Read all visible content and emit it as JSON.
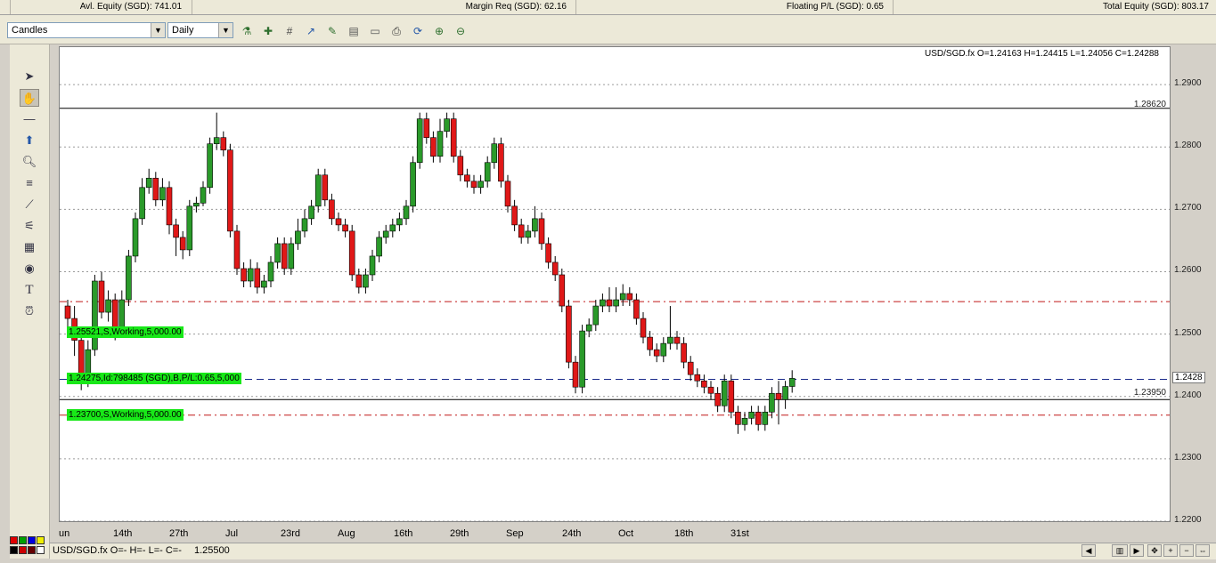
{
  "topbar": {
    "avl_equity": "Avl. Equity (SGD): 741.01",
    "margin_req": "Margin Req (SGD): 62.16",
    "floating_pl": "Floating P/L (SGD): 0.65",
    "total_equity": "Total Equity (SGD): 803.17"
  },
  "toolbar": {
    "chart_type": "Candles",
    "period": "Daily"
  },
  "chart": {
    "ohlc": "USD/SGD.fx O=1.24163 H=1.24415 L=1.24056 C=1.24288",
    "hline_top_label": "1.28620",
    "hline_bottom_label": "1.23950",
    "current_price_tag": "1.2428",
    "orders": [
      {
        "label": "1.25521,S,Working,5,000.00",
        "price": 1.25521
      },
      {
        "label": "1.24275,Id:798485 (SGD),B,P/L:0.65,5,000",
        "price": 1.24275
      },
      {
        "label": "1.23700,S,Working,5,000.00",
        "price": 1.237
      }
    ]
  },
  "chart_data": {
    "type": "candlestick",
    "symbol": "USD/SGD.fx",
    "ylim": [
      1.22,
      1.296
    ],
    "y_ticks": [
      "1.2900",
      "1.2800",
      "1.2700",
      "1.2600",
      "1.2500",
      "1.2400",
      "1.2300",
      "1.2200"
    ],
    "x_ticks": [
      "un",
      "14th",
      "27th",
      "Jul",
      "23rd",
      "Aug",
      "16th",
      "29th",
      "Sep",
      "24th",
      "Oct",
      "18th",
      "31st"
    ],
    "hlines": [
      1.2862,
      1.2395
    ],
    "candles": [
      [
        1.2545,
        1.2525,
        1.2555,
        1.251
      ],
      [
        1.2525,
        1.249,
        1.2545,
        1.2465
      ],
      [
        1.249,
        1.2425,
        1.2505,
        1.241
      ],
      [
        1.2425,
        1.2475,
        1.249,
        1.2415
      ],
      [
        1.2475,
        1.2585,
        1.2595,
        1.2465
      ],
      [
        1.2585,
        1.2535,
        1.26,
        1.2525
      ],
      [
        1.2535,
        1.2555,
        1.257,
        1.252
      ],
      [
        1.2555,
        1.2505,
        1.2565,
        1.249
      ],
      [
        1.2505,
        1.2555,
        1.257,
        1.2495
      ],
      [
        1.2555,
        1.2625,
        1.2635,
        1.2545
      ],
      [
        1.2625,
        1.2685,
        1.2695,
        1.2615
      ],
      [
        1.2685,
        1.2735,
        1.275,
        1.2675
      ],
      [
        1.2735,
        1.275,
        1.2765,
        1.2725
      ],
      [
        1.275,
        1.2715,
        1.276,
        1.2705
      ],
      [
        1.2715,
        1.2735,
        1.275,
        1.2705
      ],
      [
        1.2735,
        1.2675,
        1.2745,
        1.266
      ],
      [
        1.2675,
        1.2655,
        1.2685,
        1.2625
      ],
      [
        1.2655,
        1.2635,
        1.2665,
        1.262
      ],
      [
        1.2635,
        1.2705,
        1.2715,
        1.2625
      ],
      [
        1.2705,
        1.271,
        1.272,
        1.2695
      ],
      [
        1.271,
        1.2735,
        1.2745,
        1.2705
      ],
      [
        1.2735,
        1.2805,
        1.2815,
        1.2725
      ],
      [
        1.2805,
        1.2815,
        1.2855,
        1.2795
      ],
      [
        1.2815,
        1.2795,
        1.2825,
        1.2785
      ],
      [
        1.2795,
        1.2665,
        1.2805,
        1.2655
      ],
      [
        1.2665,
        1.2605,
        1.2675,
        1.2595
      ],
      [
        1.2605,
        1.2585,
        1.2615,
        1.2575
      ],
      [
        1.2585,
        1.2605,
        1.262,
        1.2575
      ],
      [
        1.2605,
        1.2575,
        1.2615,
        1.2565
      ],
      [
        1.2575,
        1.2585,
        1.2595,
        1.2565
      ],
      [
        1.2585,
        1.2615,
        1.2625,
        1.2575
      ],
      [
        1.2615,
        1.2645,
        1.2655,
        1.2605
      ],
      [
        1.2645,
        1.2605,
        1.2655,
        1.2595
      ],
      [
        1.2605,
        1.2645,
        1.2655,
        1.2595
      ],
      [
        1.2645,
        1.2665,
        1.2685,
        1.2635
      ],
      [
        1.2665,
        1.2685,
        1.27,
        1.2655
      ],
      [
        1.2685,
        1.2705,
        1.2715,
        1.2675
      ],
      [
        1.2705,
        1.2755,
        1.2765,
        1.2695
      ],
      [
        1.2755,
        1.2715,
        1.2765,
        1.2705
      ],
      [
        1.2715,
        1.2685,
        1.2725,
        1.2675
      ],
      [
        1.2685,
        1.2675,
        1.2695,
        1.2665
      ],
      [
        1.2675,
        1.2665,
        1.2685,
        1.2655
      ],
      [
        1.2665,
        1.2595,
        1.2675,
        1.2585
      ],
      [
        1.2595,
        1.2575,
        1.2605,
        1.2565
      ],
      [
        1.2575,
        1.2595,
        1.2605,
        1.2565
      ],
      [
        1.2595,
        1.2625,
        1.2635,
        1.2585
      ],
      [
        1.2625,
        1.2655,
        1.2665,
        1.2615
      ],
      [
        1.2655,
        1.2665,
        1.2675,
        1.2645
      ],
      [
        1.2665,
        1.2675,
        1.2685,
        1.2655
      ],
      [
        1.2675,
        1.2685,
        1.2695,
        1.2665
      ],
      [
        1.2685,
        1.2705,
        1.2715,
        1.2675
      ],
      [
        1.2705,
        1.2775,
        1.2785,
        1.2695
      ],
      [
        1.2775,
        1.2845,
        1.2855,
        1.2765
      ],
      [
        1.2845,
        1.2815,
        1.2855,
        1.2805
      ],
      [
        1.2815,
        1.2785,
        1.2825,
        1.2775
      ],
      [
        1.2785,
        1.2825,
        1.2845,
        1.2775
      ],
      [
        1.2825,
        1.2845,
        1.2855,
        1.2815
      ],
      [
        1.2845,
        1.2785,
        1.2855,
        1.2775
      ],
      [
        1.2785,
        1.2755,
        1.2795,
        1.2745
      ],
      [
        1.2755,
        1.2745,
        1.2765,
        1.2735
      ],
      [
        1.2745,
        1.2735,
        1.2755,
        1.2725
      ],
      [
        1.2735,
        1.2745,
        1.2755,
        1.2725
      ],
      [
        1.2745,
        1.2775,
        1.2785,
        1.2735
      ],
      [
        1.2775,
        1.2805,
        1.2815,
        1.2765
      ],
      [
        1.2805,
        1.2745,
        1.2815,
        1.2735
      ],
      [
        1.2745,
        1.2705,
        1.2755,
        1.2695
      ],
      [
        1.2705,
        1.2675,
        1.2715,
        1.2665
      ],
      [
        1.2675,
        1.2655,
        1.2685,
        1.2645
      ],
      [
        1.2655,
        1.2665,
        1.2675,
        1.2645
      ],
      [
        1.2665,
        1.2685,
        1.2705,
        1.2655
      ],
      [
        1.2685,
        1.2645,
        1.2695,
        1.2635
      ],
      [
        1.2645,
        1.2615,
        1.2655,
        1.2605
      ],
      [
        1.2615,
        1.2595,
        1.2625,
        1.2585
      ],
      [
        1.2595,
        1.2545,
        1.2605,
        1.2535
      ],
      [
        1.2545,
        1.2455,
        1.2555,
        1.2445
      ],
      [
        1.2455,
        1.2415,
        1.2465,
        1.2405
      ],
      [
        1.2415,
        1.2505,
        1.2515,
        1.2405
      ],
      [
        1.2505,
        1.2515,
        1.2525,
        1.2495
      ],
      [
        1.2515,
        1.2545,
        1.2555,
        1.2505
      ],
      [
        1.2545,
        1.2555,
        1.2565,
        1.2535
      ],
      [
        1.2555,
        1.2545,
        1.2575,
        1.2535
      ],
      [
        1.2545,
        1.2555,
        1.2575,
        1.2535
      ],
      [
        1.2555,
        1.2565,
        1.258,
        1.2545
      ],
      [
        1.2565,
        1.2555,
        1.2575,
        1.2545
      ],
      [
        1.2555,
        1.2525,
        1.2565,
        1.2515
      ],
      [
        1.2525,
        1.2495,
        1.2535,
        1.2485
      ],
      [
        1.2495,
        1.2475,
        1.2505,
        1.2465
      ],
      [
        1.2475,
        1.2465,
        1.2485,
        1.2455
      ],
      [
        1.2465,
        1.2485,
        1.2495,
        1.2455
      ],
      [
        1.2485,
        1.2495,
        1.2545,
        1.2475
      ],
      [
        1.2495,
        1.2485,
        1.2505,
        1.2475
      ],
      [
        1.2485,
        1.2455,
        1.2495,
        1.2445
      ],
      [
        1.2455,
        1.2435,
        1.2465,
        1.2425
      ],
      [
        1.2435,
        1.2425,
        1.2445,
        1.2415
      ],
      [
        1.2425,
        1.2415,
        1.2435,
        1.2405
      ],
      [
        1.2415,
        1.2405,
        1.2425,
        1.2395
      ],
      [
        1.2405,
        1.2385,
        1.2415,
        1.2375
      ],
      [
        1.2385,
        1.2425,
        1.2435,
        1.2375
      ],
      [
        1.2425,
        1.2375,
        1.2435,
        1.2365
      ],
      [
        1.2375,
        1.2355,
        1.2385,
        1.234
      ],
      [
        1.2355,
        1.2365,
        1.2375,
        1.2345
      ],
      [
        1.2365,
        1.2375,
        1.2385,
        1.2355
      ],
      [
        1.2375,
        1.2355,
        1.2385,
        1.2345
      ],
      [
        1.2355,
        1.2375,
        1.2385,
        1.2345
      ],
      [
        1.2375,
        1.2405,
        1.2415,
        1.2365
      ],
      [
        1.2405,
        1.2395,
        1.2425,
        1.2355
      ],
      [
        1.2395,
        1.2416,
        1.2425,
        1.238
      ],
      [
        1.2416,
        1.2429,
        1.2442,
        1.2406
      ]
    ]
  },
  "statusbar": {
    "symbol_line": "USD/SGD.fx O=- H=- L=- C=-",
    "price": "1.25500"
  }
}
